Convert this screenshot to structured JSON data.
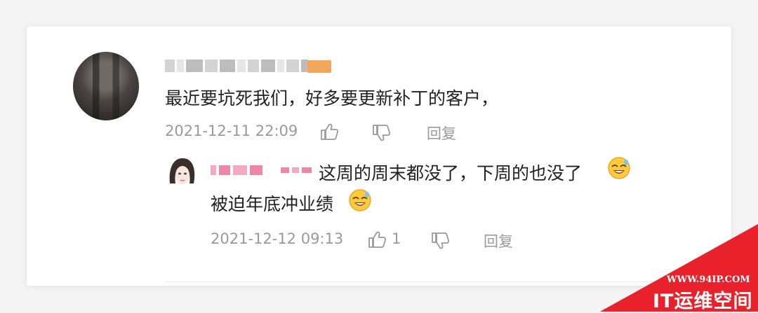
{
  "main_comment": {
    "text": "最近要坑死我们，好多要更新补丁的客户，",
    "timestamp": "2021-12-11 22:09",
    "reply_label": "回复",
    "like_icon": "thumbs-up-icon",
    "dislike_icon": "thumbs-down-icon"
  },
  "reply_comment": {
    "text_line1": "这周的周末都没了，下周的也没了",
    "text_line2": "被迫年底冲业绩",
    "emoji": "sweat-laugh-emoji",
    "timestamp": "2021-12-12 09:13",
    "like_count": "1",
    "reply_label": "回复"
  },
  "watermark": {
    "url": "WWW.94IP.COM",
    "title": "IT运维空间",
    "color": "#e8212b"
  }
}
